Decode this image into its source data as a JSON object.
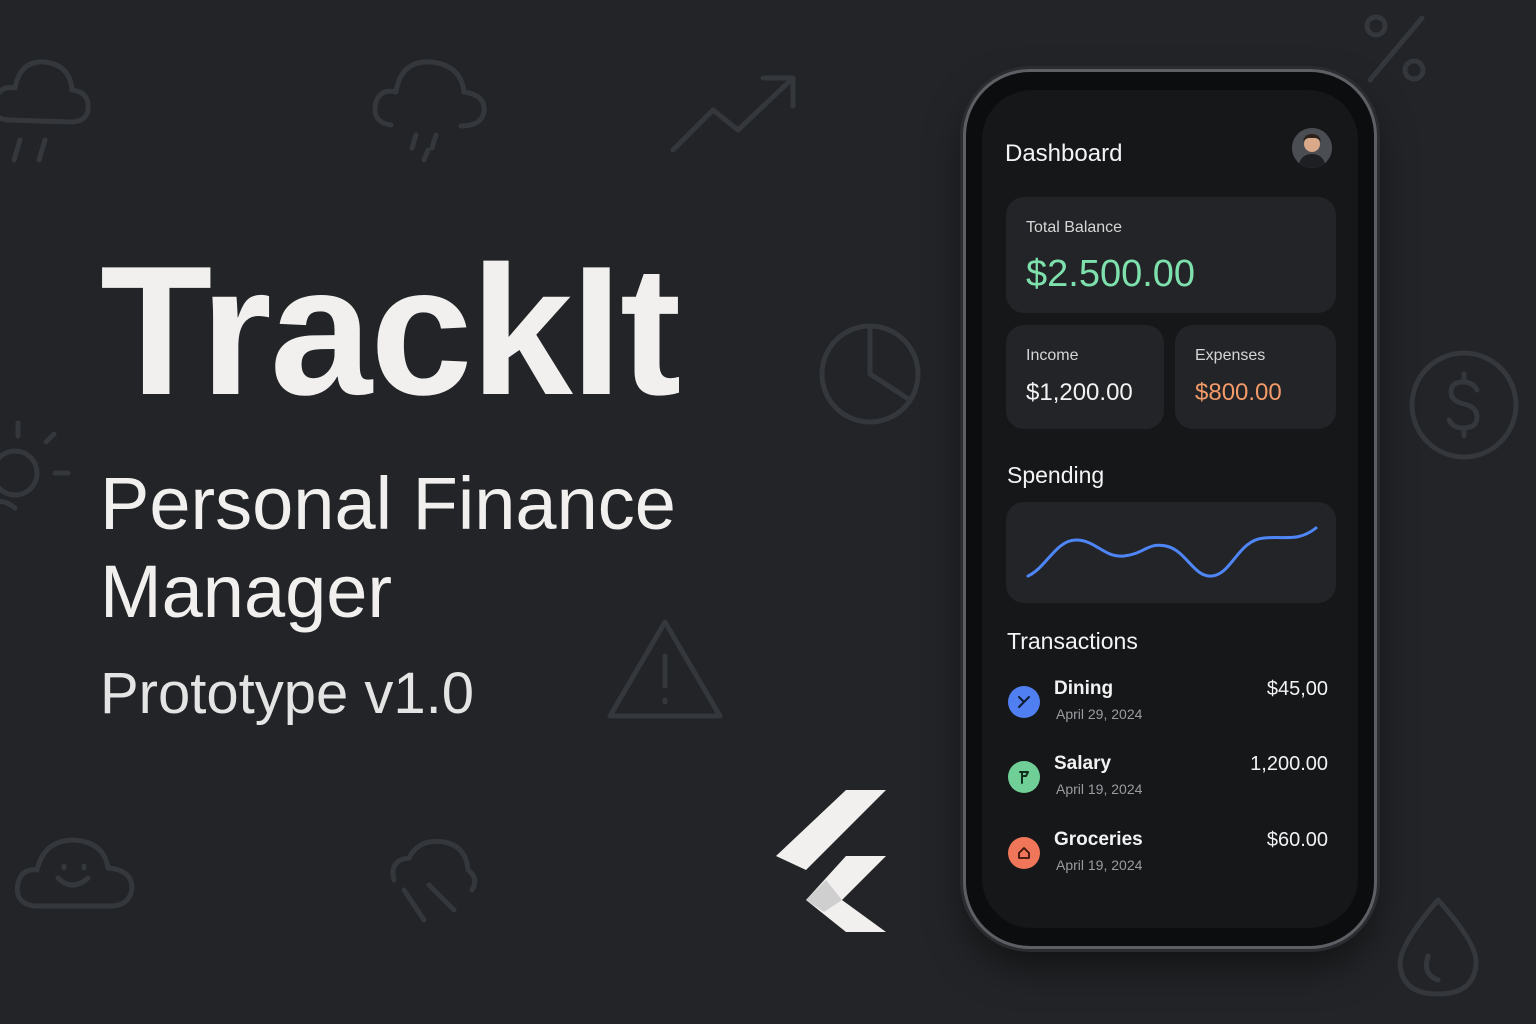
{
  "hero": {
    "title": "TrackIt",
    "subtitle": "Personal Finance Manager",
    "version": "Prototype v1.0"
  },
  "background_icons": [
    "cloud-rain-icon",
    "trend-up-icon",
    "percent-icon",
    "pie-chart-icon",
    "dollar-circle-icon",
    "sun-cloud-icon",
    "warning-icon",
    "cloud-smile-icon",
    "cloud-wind-icon",
    "drop-icon"
  ],
  "logo": "flutter-logo-icon",
  "app": {
    "screen_title": "Dashboard",
    "avatar": "user-avatar-icon",
    "balance": {
      "label": "Total Balance",
      "value": "$2.500.00"
    },
    "income": {
      "label": "Income",
      "value": "$1,200.00"
    },
    "expenses": {
      "label": "Expenses",
      "value": "$800.00"
    },
    "spending": {
      "title": "Spending",
      "line_color": "#4f86f7"
    },
    "transactions": {
      "title": "Transactions",
      "items": [
        {
          "name": "Dining",
          "date": "April 29, 2024",
          "amount": "$45,00",
          "icon": "utensils-icon",
          "color": "#4f7ff0"
        },
        {
          "name": "Salary",
          "date": "April 19, 2024",
          "amount": "1,200.00",
          "icon": "flag-icon",
          "color": "#6fcf97"
        },
        {
          "name": "Groceries",
          "date": "April 19, 2024",
          "amount": "$60.00",
          "icon": "home-icon",
          "color": "#f0765a"
        }
      ]
    }
  },
  "colors": {
    "background": "#222427",
    "balance_green": "#7ee0ad",
    "expense_orange": "#f39a68"
  }
}
